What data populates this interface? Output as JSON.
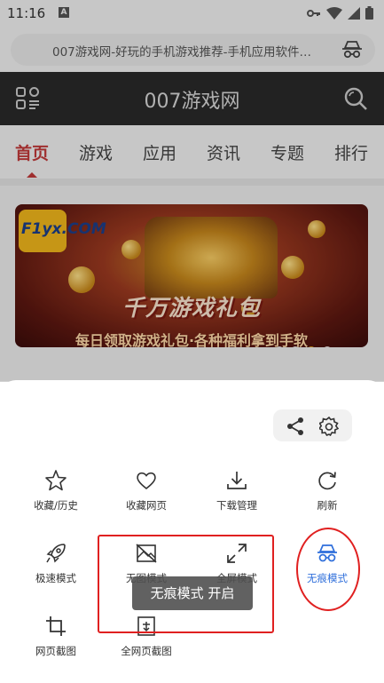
{
  "status_bar": {
    "time": "11:16",
    "notification_letter": "A"
  },
  "url_bar": {
    "text": "007游戏网-好玩的手机游戏推荐-手机应用软件…",
    "icon": "incognito-icon"
  },
  "site_header": {
    "title": "007游戏网",
    "menu_icon": "grid-menu-icon",
    "search_icon": "search-icon"
  },
  "nav": {
    "tabs": [
      "首页",
      "游戏",
      "应用",
      "资讯",
      "专题",
      "排行"
    ],
    "active_index": 0
  },
  "banner": {
    "logo_text": "F1yx.COM",
    "headline": "千万游戏礼包",
    "subtitle": "每日领取游戏礼包·各种福利拿到手软",
    "dot_count": 4,
    "active_dot": 2
  },
  "sheet": {
    "tools": [
      "share-icon",
      "gear-icon"
    ],
    "items": [
      {
        "label": "收藏/历史",
        "icon": "star-icon"
      },
      {
        "label": "收藏网页",
        "icon": "heart-icon"
      },
      {
        "label": "下载管理",
        "icon": "download-icon"
      },
      {
        "label": "刷新",
        "icon": "refresh-icon"
      },
      {
        "label": "极速模式",
        "icon": "rocket-icon"
      },
      {
        "label": "无图模式",
        "icon": "no-image-icon"
      },
      {
        "label": "全屏模式",
        "icon": "fullscreen-icon"
      },
      {
        "label": "无痕模式",
        "icon": "incognito-icon",
        "active": true
      },
      {
        "label": "网页截图",
        "icon": "crop-icon"
      },
      {
        "label": "全网页截图",
        "icon": "full-page-screenshot-icon"
      }
    ]
  },
  "toast": {
    "text": "无痕模式  开启"
  },
  "colors": {
    "accent_red": "#c23a3a",
    "active_blue": "#2f6fdb",
    "annotation_red": "#e02020"
  }
}
